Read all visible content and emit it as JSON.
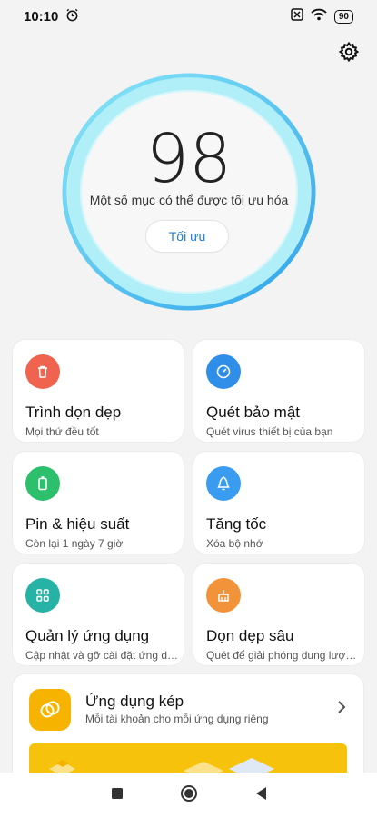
{
  "status_bar": {
    "time": "10:10",
    "battery": "90"
  },
  "score": {
    "value": "98",
    "message": "Một số mục có thể được tối ưu hóa",
    "button_label": "Tối ưu"
  },
  "cards": [
    {
      "title": "Trình dọn dẹp",
      "subtitle": "Mọi thứ đều tốt",
      "icon": "trash-icon",
      "color": "#f0644f"
    },
    {
      "title": "Quét bảo mật",
      "subtitle": "Quét virus thiết bị của bạn",
      "icon": "timer-icon",
      "color": "#2e8ee8"
    },
    {
      "title": "Pin & hiệu suất",
      "subtitle": "Còn lại 1 ngày 7 giờ",
      "icon": "battery-icon",
      "color": "#2cbf6c"
    },
    {
      "title": "Tăng tốc",
      "subtitle": "Xóa bộ nhớ",
      "icon": "rocket-icon",
      "color": "#3a9cf0"
    },
    {
      "title": "Quản lý ứng dụng",
      "subtitle": "Cập nhật và gỡ cài đặt ứng dụng",
      "icon": "grid-icon",
      "color": "#26b3a6"
    },
    {
      "title": "Dọn dẹp sâu",
      "subtitle": "Quét để giải phóng dung lượng...",
      "icon": "broom-icon",
      "color": "#f2933a"
    }
  ],
  "dual_apps": {
    "title": "Ứng dụng kép",
    "subtitle": "Mỗi tài khoản cho mỗi ứng dụng riêng",
    "icon": "dual-app-icon",
    "color": "#f6b400"
  },
  "colors": {
    "accent": "#1a7fe0",
    "ring_outer": "#2fa9ec",
    "ring_inner": "#7fe3f5"
  }
}
